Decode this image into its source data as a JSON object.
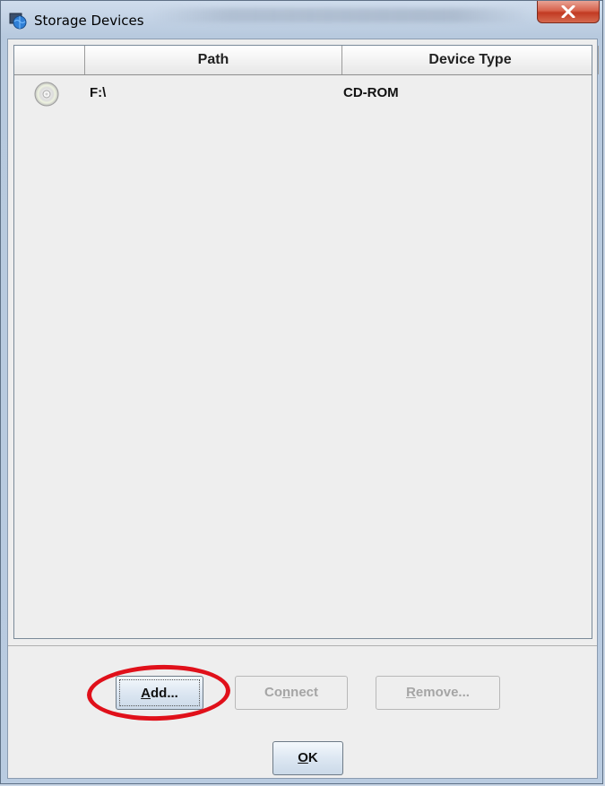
{
  "window": {
    "title": "Storage Devices",
    "close_icon": "close-icon"
  },
  "table": {
    "columns": [
      "",
      "Path",
      "Device Type"
    ],
    "rows": [
      {
        "icon": "cd-rom-icon",
        "path": "F:\\",
        "device_type": "CD-ROM"
      }
    ]
  },
  "buttons": {
    "add": {
      "mnemonic": "A",
      "rest": "dd..."
    },
    "connect": {
      "pre": "Co",
      "mnemonic": "n",
      "rest": "nect"
    },
    "remove": {
      "mnemonic": "R",
      "rest": "emove..."
    },
    "ok": {
      "mnemonic": "O",
      "rest": "K"
    }
  },
  "colors": {
    "annotation": "#e0101a",
    "close_button": "#c23a22"
  }
}
